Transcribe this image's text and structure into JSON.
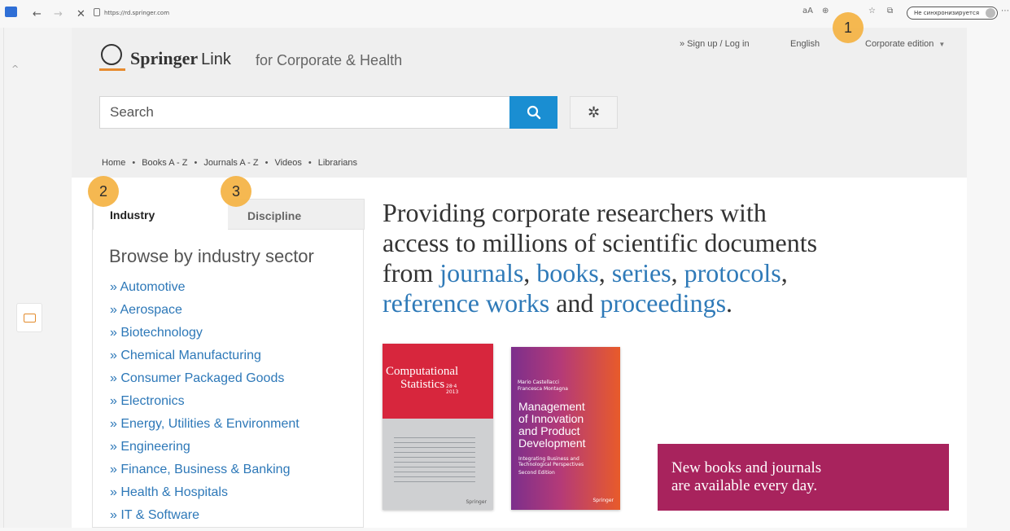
{
  "browser": {
    "url": "https://rd.springer.com",
    "sync_label": "Не синхронизируется",
    "nav_back": "←",
    "nav_forward": "→",
    "nav_stop": "✕",
    "reader_icon_text": "aA",
    "more_dots": "⋯"
  },
  "header": {
    "logo_springer": "Springer",
    "logo_link": "Link",
    "logo_sub": "for Corporate & Health",
    "signup_label": "» Sign up / Log in",
    "language_label": "English",
    "edition_label": "Corporate edition"
  },
  "search": {
    "placeholder": "Search",
    "search_glyph": "⚲",
    "settings_glyph": "✲"
  },
  "breadcrumbs": [
    "Home",
    "Books A - Z",
    "Journals A - Z",
    "Videos",
    "Librarians"
  ],
  "tabs": {
    "industry": "Industry",
    "discipline": "Discipline"
  },
  "sidebar": {
    "title": "Browse by industry sector",
    "items": [
      "» Automotive",
      "» Aerospace",
      "» Biotechnology",
      "» Chemical Manufacturing",
      "» Consumer Packaged Goods",
      "» Electronics",
      "» Energy, Utilities & Environment",
      "» Engineering",
      "» Finance, Business & Banking",
      "» Health & Hospitals",
      "» IT & Software"
    ]
  },
  "hero": {
    "line1": "Providing corporate researchers with",
    "line2": "access to millions of scientific documents",
    "from": "from ",
    "journals": "journals",
    "comma1": ", ",
    "books": "books",
    "comma2": ", ",
    "series": "series",
    "comma3": ", ",
    "protocols": "protocols",
    "comma4": ",",
    "reference_works": "reference works",
    "and": " and ",
    "proceedings": "proceedings",
    "period": "."
  },
  "books": {
    "cs_title_1": "Computational",
    "cs_title_2": "Statistics",
    "cs_meta": "28·4",
    "cs_year": "2013",
    "cs_publisher": "Springer",
    "mi_authors_1": "Mario Castellacci",
    "mi_authors_2": "Francesca Montagna",
    "mi_title_1": "Management",
    "mi_title_2": "of Innovation",
    "mi_title_3": "and Product",
    "mi_title_4": "Development",
    "mi_subtitle": "Integrating Business and Technological Perspectives",
    "mi_edition": "Second Edition",
    "mi_publisher": "Springer"
  },
  "promo": {
    "line1": "New books and journals",
    "line2": "are available every day."
  },
  "markers": [
    "1",
    "2",
    "3"
  ],
  "colors": {
    "accent_blue": "#1a8ed2",
    "link_blue": "#2d78b8",
    "promo_magenta": "#a8235d",
    "marker_orange": "#f5b548",
    "logo_orange": "#e78b2f"
  }
}
